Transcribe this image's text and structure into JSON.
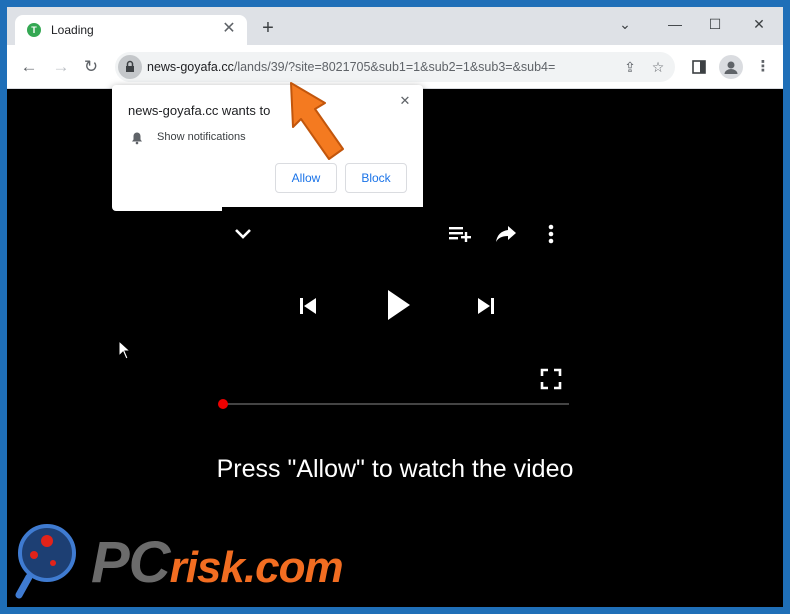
{
  "tab": {
    "favicon_letter": "T",
    "title": "Loading",
    "close": "✕"
  },
  "window_controls": {
    "chevron": "⌄",
    "minimize": "—",
    "maximize": "☐",
    "close": "✕"
  },
  "toolbar": {
    "url_domain": "news-goyafa.cc",
    "url_rest": "/lands/39/?site=8021705&sub1=1&sub2=1&sub3=&sub4="
  },
  "popup": {
    "title": "news-goyafa.cc wants to",
    "permission": "Show notifications",
    "allow_label": "Allow",
    "block_label": "Block",
    "close": "✕"
  },
  "player": {
    "caption": "Press \"Allow\" to watch the video",
    "progress": 0.0
  },
  "watermark": {
    "pc": "PC",
    "risk": "risk.com"
  },
  "colors": {
    "accent_blue": "#1a73e8",
    "arrow_orange": "#f47a20",
    "progress_red": "#e00000",
    "brand_orange": "#f26d21"
  }
}
